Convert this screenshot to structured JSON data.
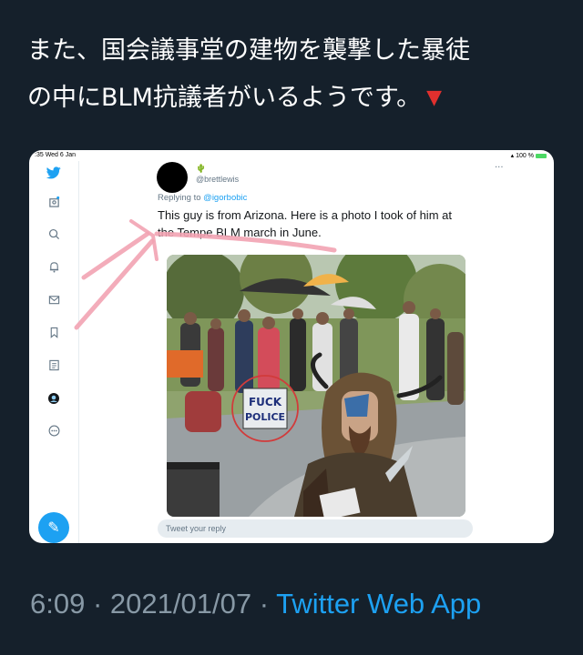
{
  "tweet": {
    "text_line1": "また、国会議事堂の建物を襲撃した暴徒",
    "text_line2": "の中にBLM抗議者がいるようです。",
    "emoji_icon": "red-down-triangle"
  },
  "screenshot": {
    "status_time": ":35",
    "status_date": "Wed 6 Jan",
    "status_battery": "100 %",
    "sidebar_icons": [
      "twitter-logo-icon",
      "home-icon",
      "search-icon",
      "bell-icon",
      "mail-icon",
      "bookmark-icon",
      "list-icon",
      "profile-icon",
      "more-icon"
    ],
    "compose_icon": "feather-icon",
    "user_handle": "@brettlewis",
    "replying_prefix": "Replying to",
    "replying_to": "@igorbobic",
    "reply_text": "This guy is from Arizona. Here is a photo I took of him at the Tempe BLM march in June.",
    "sign_line1": "FUCK",
    "sign_line2": "POLICE",
    "reply_placeholder": "Tweet your reply",
    "accent": "#1da1f2"
  },
  "meta": {
    "time": "6:09",
    "separator": "·",
    "date": "2021/01/07",
    "source": "Twitter Web App"
  }
}
